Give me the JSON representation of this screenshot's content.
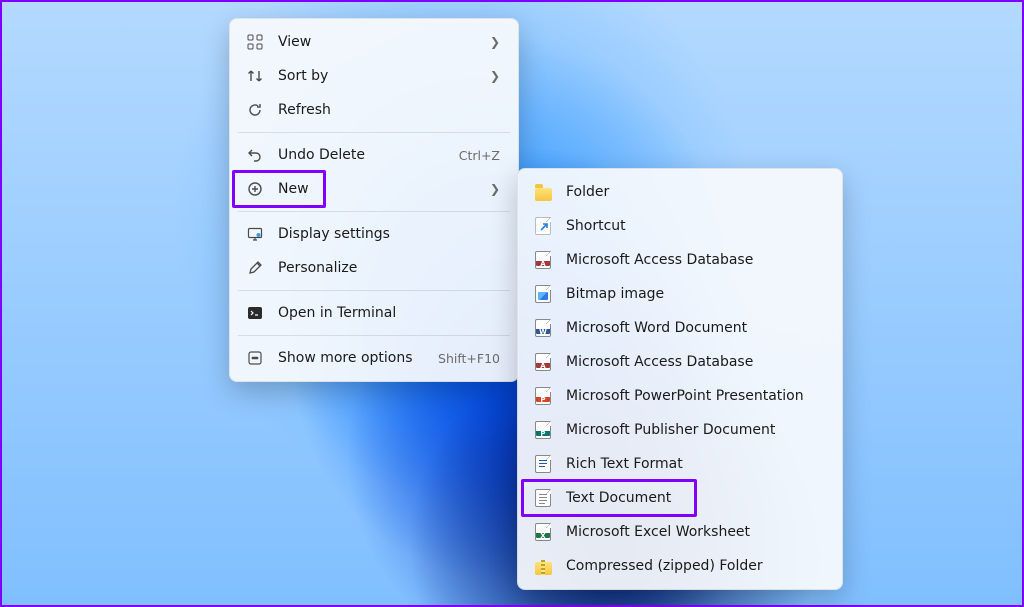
{
  "desktop": {
    "os": "Windows 11"
  },
  "mainMenu": {
    "items": [
      {
        "icon": "view-icon",
        "label": "View",
        "hasSubmenu": true
      },
      {
        "icon": "sort-icon",
        "label": "Sort by",
        "hasSubmenu": true
      },
      {
        "icon": "refresh-icon",
        "label": "Refresh"
      },
      {
        "sep": true
      },
      {
        "icon": "undo-icon",
        "label": "Undo Delete",
        "accel": "Ctrl+Z"
      },
      {
        "icon": "new-icon",
        "label": "New",
        "hasSubmenu": true,
        "highlighted": true
      },
      {
        "sep": true
      },
      {
        "icon": "display-icon",
        "label": "Display settings"
      },
      {
        "icon": "personalize-icon",
        "label": "Personalize"
      },
      {
        "sep": true
      },
      {
        "icon": "terminal-icon",
        "label": "Open in Terminal"
      },
      {
        "sep": true
      },
      {
        "icon": "more-icon",
        "label": "Show more options",
        "accel": "Shift+F10"
      }
    ]
  },
  "subMenu": {
    "items": [
      {
        "icon": "folder-icon",
        "label": "Folder"
      },
      {
        "icon": "shortcut-icon",
        "label": "Shortcut"
      },
      {
        "icon": "access-icon",
        "label": "Microsoft Access Database"
      },
      {
        "icon": "bitmap-icon",
        "label": "Bitmap image"
      },
      {
        "icon": "word-icon",
        "label": "Microsoft Word Document"
      },
      {
        "icon": "access-icon",
        "label": "Microsoft Access Database"
      },
      {
        "icon": "powerpoint-icon",
        "label": "Microsoft PowerPoint Presentation"
      },
      {
        "icon": "publisher-icon",
        "label": "Microsoft Publisher Document"
      },
      {
        "icon": "rtf-icon",
        "label": "Rich Text Format"
      },
      {
        "icon": "text-icon",
        "label": "Text Document",
        "highlighted": true
      },
      {
        "icon": "excel-icon",
        "label": "Microsoft Excel Worksheet"
      },
      {
        "icon": "zip-icon",
        "label": "Compressed (zipped) Folder"
      }
    ]
  },
  "highlight": {
    "color": "#8000ff"
  }
}
